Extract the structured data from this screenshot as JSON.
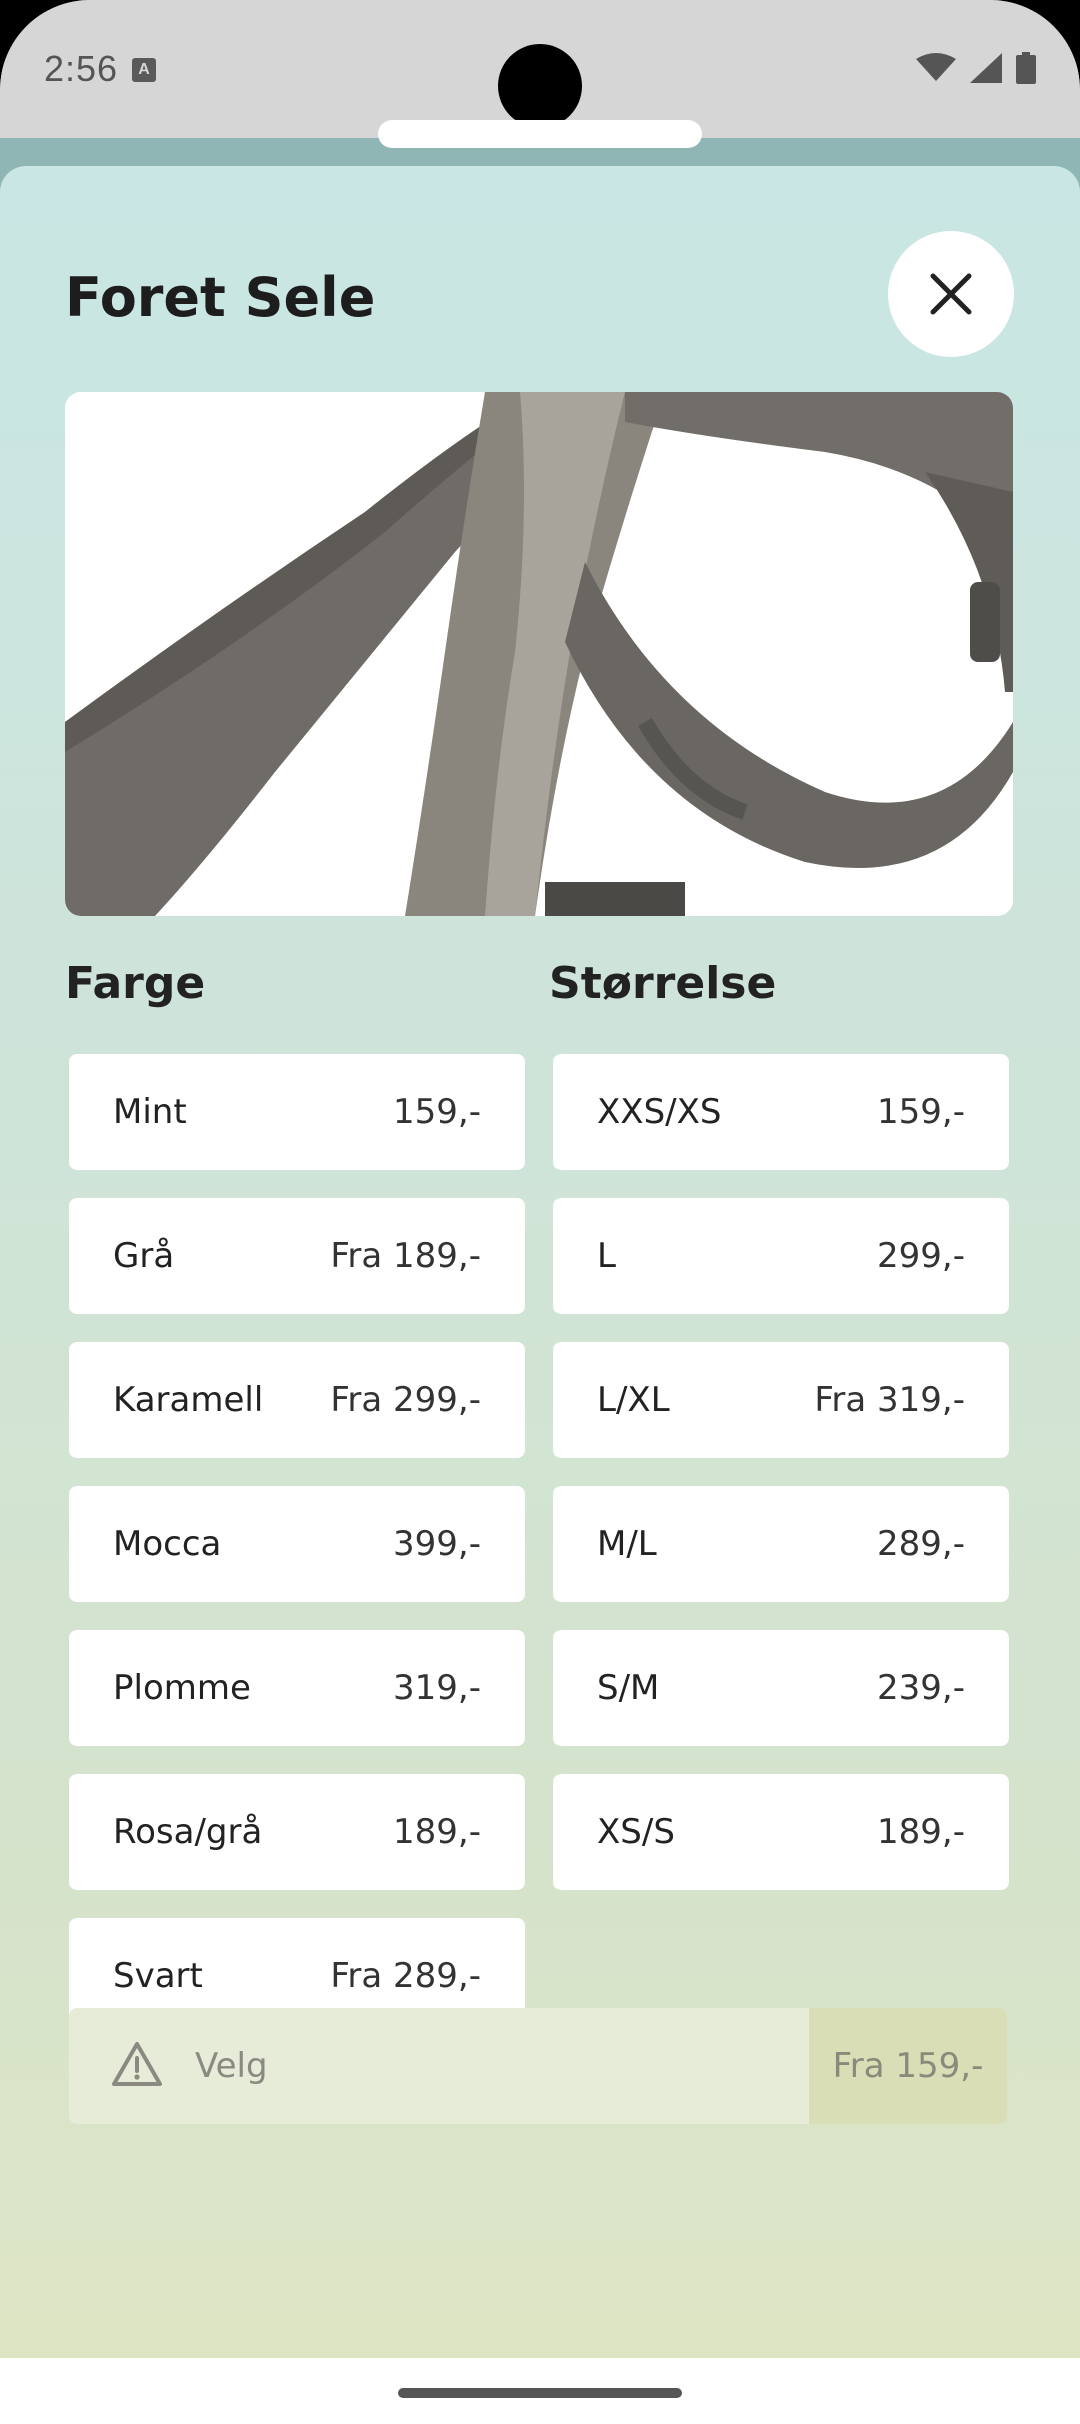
{
  "status_bar": {
    "time": "2:56",
    "notification_icon": "A"
  },
  "sheet": {
    "title": "Foret Sele",
    "close_icon": "close-icon",
    "image_alt": "harness-photo"
  },
  "colors": {
    "heading": "Farge",
    "options": [
      {
        "label": "Mint",
        "price": "159,-"
      },
      {
        "label": "Grå",
        "price": "Fra 189,-"
      },
      {
        "label": "Karamell",
        "price": "Fra 299,-"
      },
      {
        "label": "Mocca",
        "price": "399,-"
      },
      {
        "label": "Plomme",
        "price": "319,-"
      },
      {
        "label": "Rosa/grå",
        "price": "189,-"
      },
      {
        "label": "Svart",
        "price": "Fra 289,-"
      }
    ]
  },
  "sizes": {
    "heading": "Størrelse",
    "options": [
      {
        "label": "XXS/XS",
        "price": "159,-"
      },
      {
        "label": "L",
        "price": "299,-"
      },
      {
        "label": "L/XL",
        "price": "Fra 319,-"
      },
      {
        "label": "M/L",
        "price": "289,-"
      },
      {
        "label": "S/M",
        "price": "239,-"
      },
      {
        "label": "XS/S",
        "price": "189,-"
      }
    ]
  },
  "bottom_bar": {
    "label": "Velg",
    "price": "Fra 159,-",
    "icon": "warning-icon"
  },
  "theme": {
    "accent_top": "#c9e6e4",
    "accent_bottom": "#dde4c4",
    "price_box": "#d9deb7"
  }
}
